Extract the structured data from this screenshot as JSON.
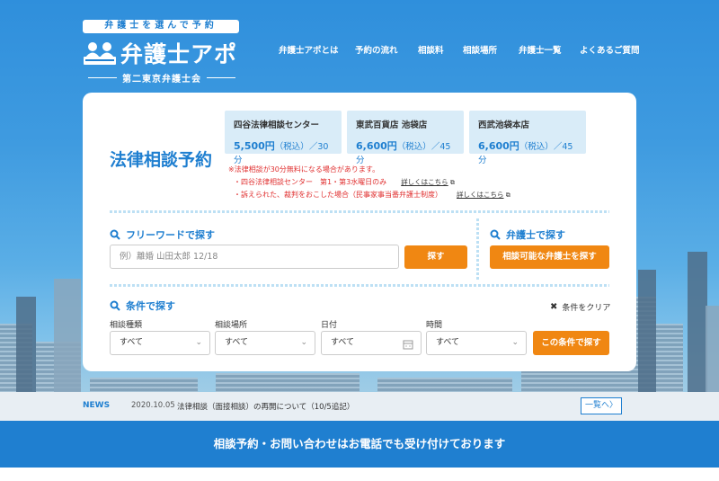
{
  "header": {
    "tagline": "弁護士を選んで予約",
    "brand": "弁護士アポ",
    "subtitle": "第二東京弁護士会",
    "nav": [
      "弁護士アポとは",
      "予約の流れ",
      "相談料",
      "相談場所",
      "弁護士一覧",
      "よくあるご質問"
    ]
  },
  "reservation": {
    "title": "法律相談予約",
    "prices": [
      {
        "name": "四谷法律相談センター",
        "price": "5,500円",
        "tax": "（税込）",
        "duration": "／30分"
      },
      {
        "name": "東武百貨店 池袋店",
        "price": "6,600円",
        "tax": "（税込）",
        "duration": "／45分"
      },
      {
        "name": "西武池袋本店",
        "price": "6,600円",
        "tax": "（税込）",
        "duration": "／45分"
      }
    ],
    "notes": {
      "headline": "※法律相談が30分無料になる場合があります。",
      "item1": "・四谷法律相談センター　第1・第3水曜日のみ",
      "item2": "・訴えられた、裁判をおこした場合（民事家事当番弁護士制度）",
      "link": "詳しくはこちら"
    },
    "freeword": {
      "heading": "フリーワードで探す",
      "placeholder": "例）離婚 山田太郎 12/18",
      "button": "探す"
    },
    "lawyer": {
      "heading": "弁護士で探す",
      "button": "相談可能な弁護士を探す"
    },
    "conditions": {
      "heading": "条件で探す",
      "clear": "条件をクリア",
      "fields": [
        {
          "label": "相談種類",
          "value": "すべて"
        },
        {
          "label": "相談場所",
          "value": "すべて"
        },
        {
          "label": "日付",
          "value": "すべて"
        },
        {
          "label": "時間",
          "value": "すべて"
        }
      ],
      "button": "この条件で探す"
    }
  },
  "news": {
    "tag": "NEWS",
    "date": "2020.10.05",
    "text": "法律相談（面接相談）の再開について（10/5追記）",
    "more": "一覧へ〉"
  },
  "contact_banner": "相談予約・お問い合わせはお電話でも受け付けております",
  "colors": {
    "primary": "#1f7fd0",
    "accent": "#f08712"
  }
}
